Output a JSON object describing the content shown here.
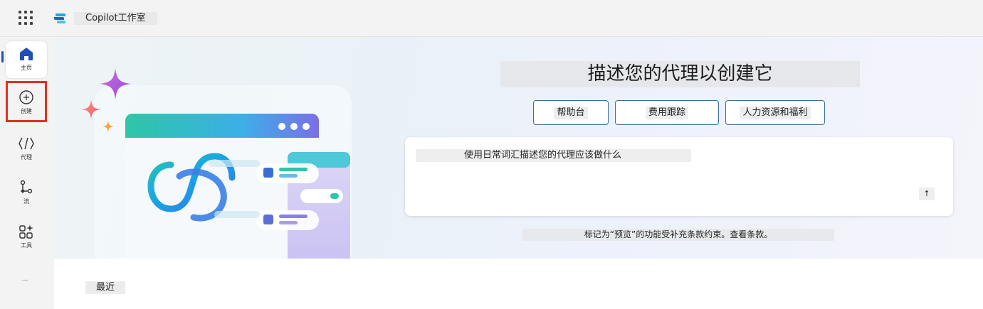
{
  "header": {
    "app_title": "Copilot工作室",
    "waffle_icon": "app-launcher-icon",
    "logo_icon": "copilot-studio-logo"
  },
  "nav": {
    "items": [
      {
        "label": "主页",
        "icon": "home-icon",
        "selected": true
      },
      {
        "label": "创建",
        "icon": "plus-circle-icon"
      },
      {
        "label": "代理",
        "icon": "agent-code-icon"
      },
      {
        "label": "流",
        "icon": "flow-icon"
      },
      {
        "label": "工具",
        "icon": "tools-icon"
      }
    ],
    "more_label": "…",
    "accent_color": "#1d4fb8",
    "highlight_color": "#e3321d"
  },
  "hero": {
    "title": "描述您的代理以创建它",
    "suggestions": [
      "帮助台",
      "费用跟踪",
      "人力资源和福利"
    ],
    "prompt_placeholder": "使用日常词汇描述您的代理应该做什么",
    "send_label": "↑",
    "terms": "标记为“预览”的功能受补充条款约束。查看条款。"
  },
  "recent": {
    "label": "最近"
  }
}
